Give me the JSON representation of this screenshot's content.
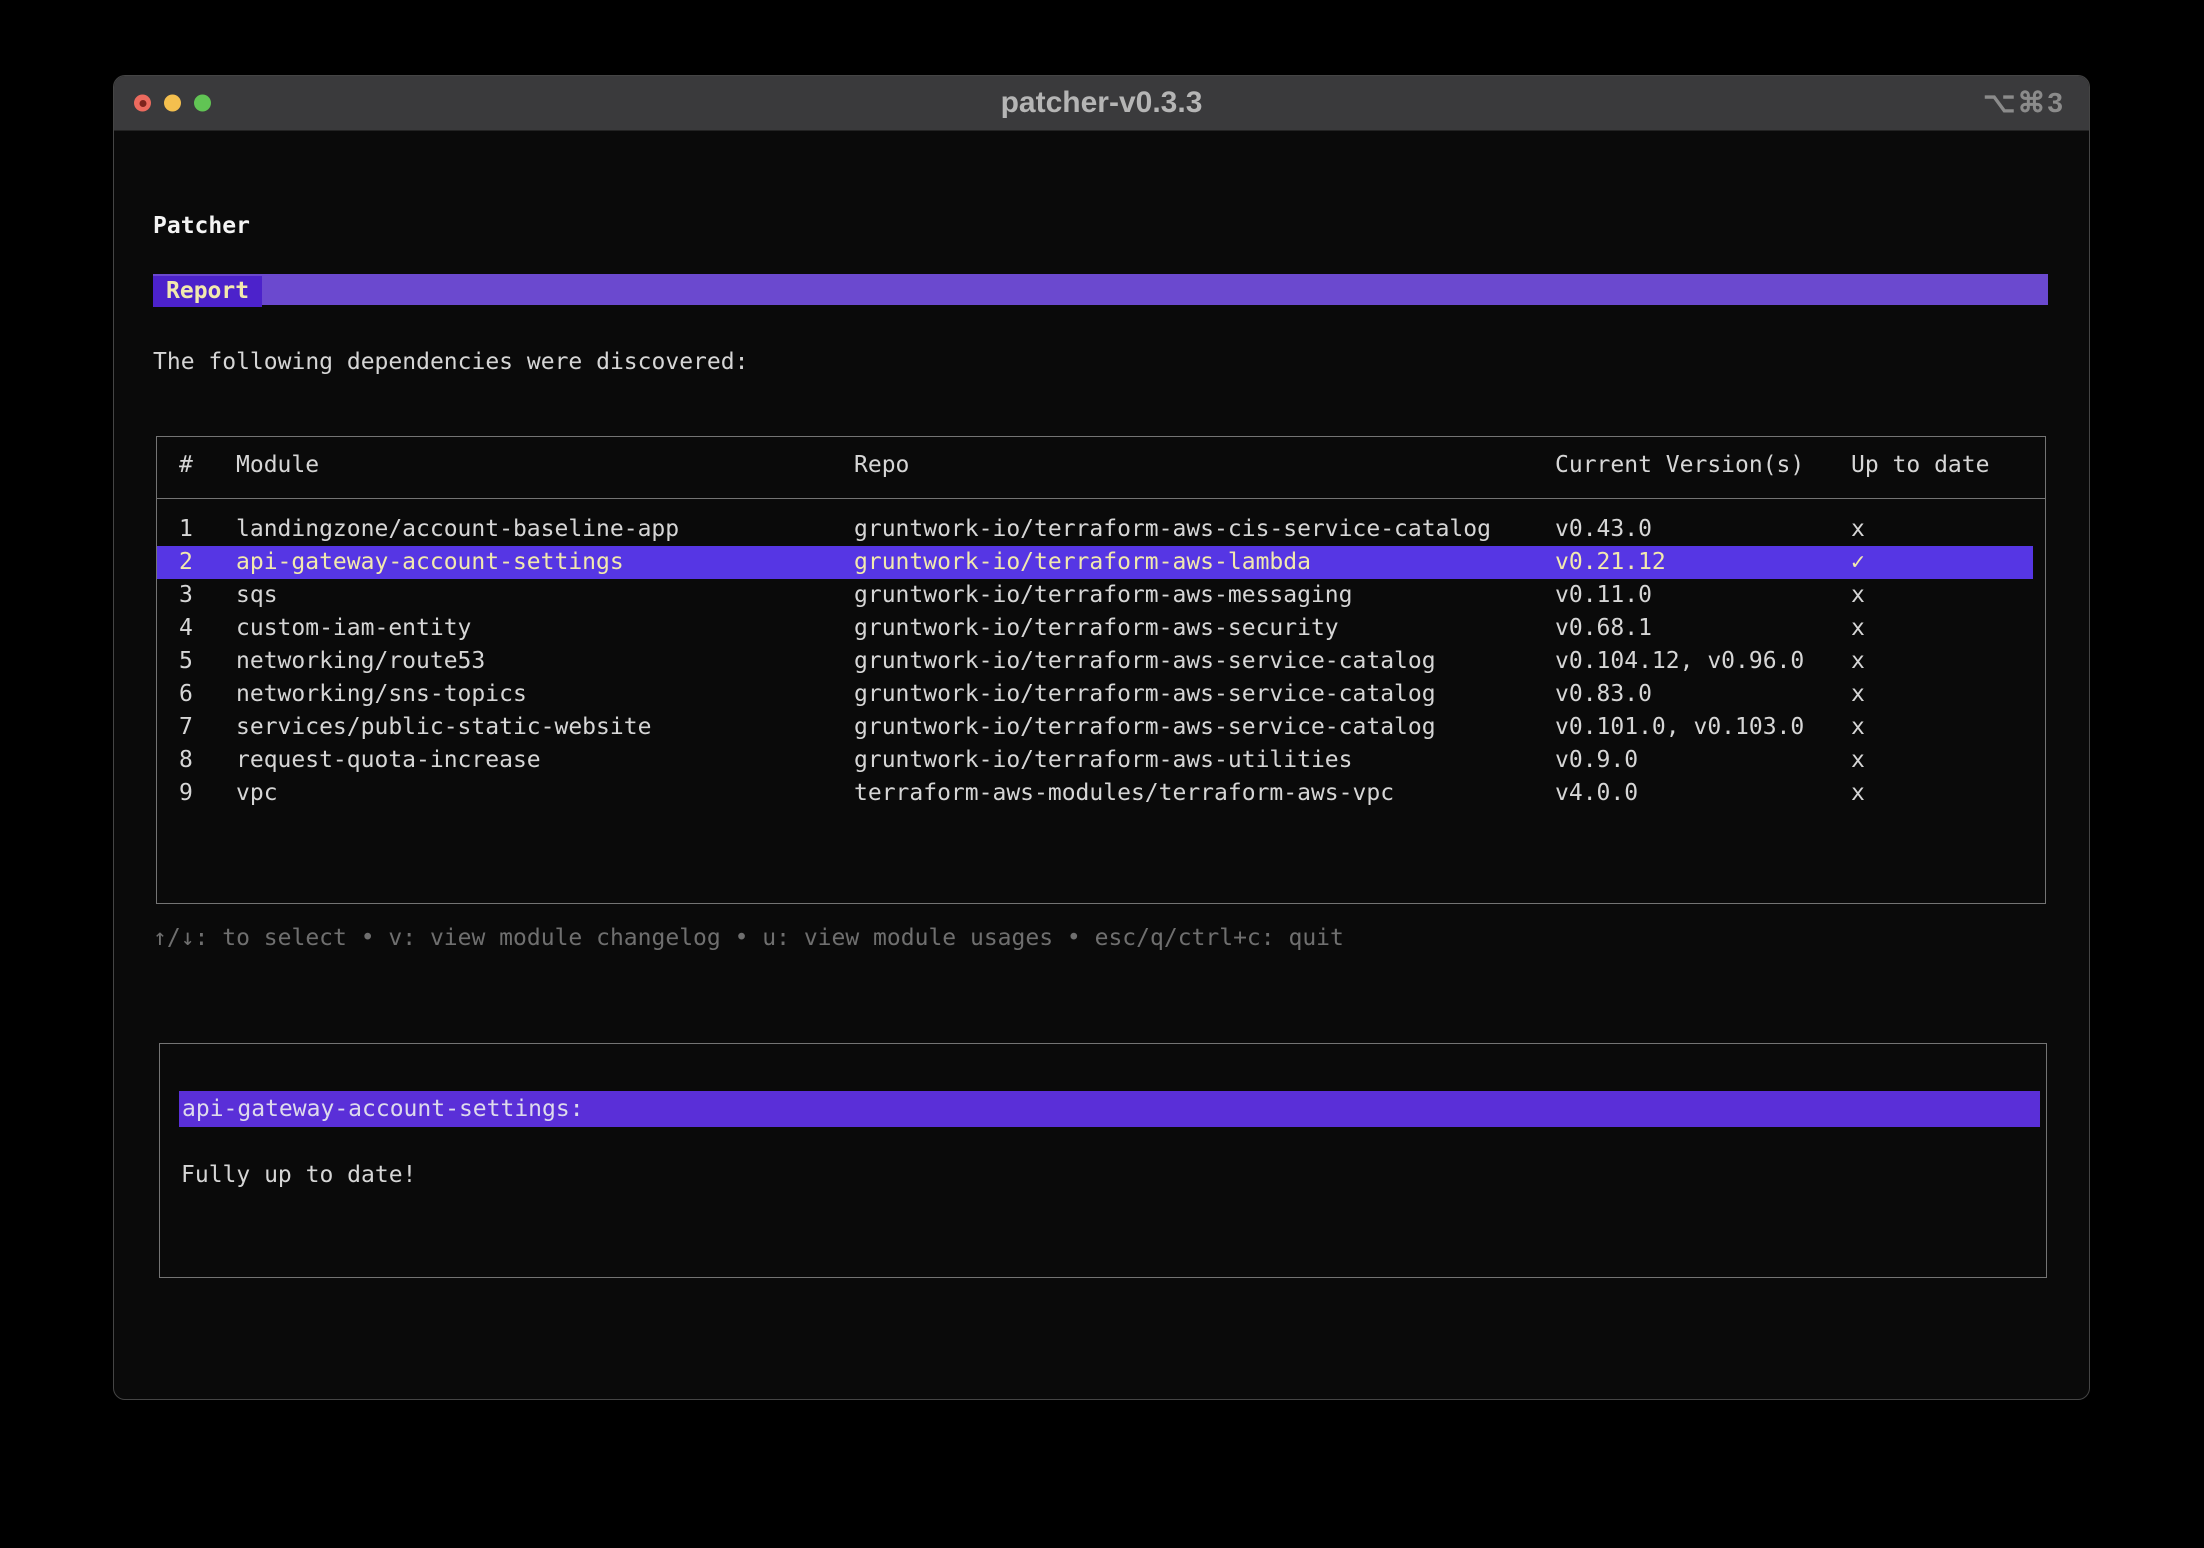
{
  "window": {
    "title": "patcher-v0.3.3",
    "shortcut": "⌥⌘3"
  },
  "colors": {
    "accent_tab": "#4c22cb",
    "accent_tabbar": "#6b49cf",
    "accent_selected_row": "#5636e4",
    "accent_detail_bar": "#5a2fd8",
    "selected_text": "#f2e9ae",
    "terminal_fg": "#d6d6d6",
    "help_fg": "#6f6f6f",
    "titlebar_bg": "#3a3a3c",
    "traffic_red": "#ec6a5e",
    "traffic_yellow": "#f4bf4e",
    "traffic_green": "#61c454"
  },
  "app": {
    "heading": "Patcher",
    "tab_label": "Report",
    "intro": "The following dependencies were discovered:",
    "table": {
      "headers": {
        "index": "#",
        "module": "Module",
        "repo": "Repo",
        "version": "Current Version(s)",
        "up_to_date": "Up to date"
      },
      "rows": [
        {
          "index": "1",
          "module": "landingzone/account-baseline-app",
          "repo": "gruntwork-io/terraform-aws-cis-service-catalog",
          "version": "v0.43.0",
          "up_to_date": "x",
          "selected": false
        },
        {
          "index": "2",
          "module": "api-gateway-account-settings",
          "repo": "gruntwork-io/terraform-aws-lambda",
          "version": "v0.21.12",
          "up_to_date": "✓",
          "selected": true
        },
        {
          "index": "3",
          "module": "sqs",
          "repo": "gruntwork-io/terraform-aws-messaging",
          "version": "v0.11.0",
          "up_to_date": "x",
          "selected": false
        },
        {
          "index": "4",
          "module": "custom-iam-entity",
          "repo": "gruntwork-io/terraform-aws-security",
          "version": "v0.68.1",
          "up_to_date": "x",
          "selected": false
        },
        {
          "index": "5",
          "module": "networking/route53",
          "repo": "gruntwork-io/terraform-aws-service-catalog",
          "version": "v0.104.12, v0.96.0",
          "up_to_date": "x",
          "selected": false
        },
        {
          "index": "6",
          "module": "networking/sns-topics",
          "repo": "gruntwork-io/terraform-aws-service-catalog",
          "version": "v0.83.0",
          "up_to_date": "x",
          "selected": false
        },
        {
          "index": "7",
          "module": "services/public-static-website",
          "repo": "gruntwork-io/terraform-aws-service-catalog",
          "version": "v0.101.0, v0.103.0",
          "up_to_date": "x",
          "selected": false
        },
        {
          "index": "8",
          "module": "request-quota-increase",
          "repo": "gruntwork-io/terraform-aws-utilities",
          "version": "v0.9.0",
          "up_to_date": "x",
          "selected": false
        },
        {
          "index": "9",
          "module": "vpc",
          "repo": "terraform-aws-modules/terraform-aws-vpc",
          "version": "v4.0.0",
          "up_to_date": "x",
          "selected": false
        }
      ]
    },
    "help": "↑/↓: to select • v: view module changelog • u: view module usages • esc/q/ctrl+c: quit",
    "detail": {
      "title": "api-gateway-account-settings:",
      "body": "Fully up to date!"
    }
  }
}
